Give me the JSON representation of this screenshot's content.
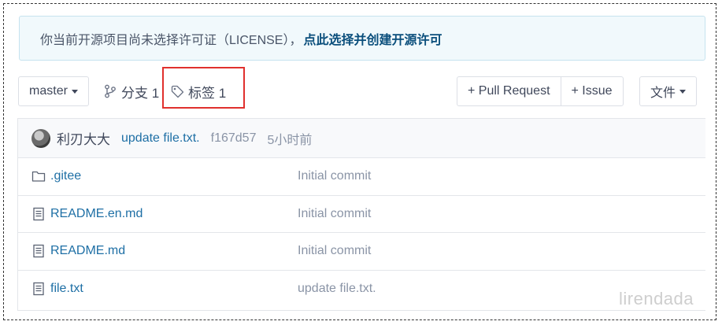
{
  "notice": {
    "text": "你当前开源项目尚未选择许可证（LICENSE），",
    "link": "点此选择并创建开源许可"
  },
  "toolbar": {
    "branch_select": "master",
    "branches_label": "分支 1",
    "tags_label": "标签 1",
    "pull_request_label": "+ Pull Request",
    "issue_label": "+ Issue",
    "files_label": "文件"
  },
  "latest_commit": {
    "author": "利刃大大",
    "message": "update file.txt.",
    "sha": "f167d57",
    "time": "5小时前"
  },
  "files": [
    {
      "name": ".gitee",
      "type": "folder-icon",
      "commit": "Initial commit"
    },
    {
      "name": "README.en.md",
      "type": "file-icon",
      "commit": "Initial commit"
    },
    {
      "name": "README.md",
      "type": "file-icon",
      "commit": "Initial commit"
    },
    {
      "name": "file.txt",
      "type": "file-icon",
      "commit": "update file.txt."
    }
  ],
  "watermark": "lirendada",
  "colors": {
    "highlight_box": "#e0302d",
    "link": "#1e6fa5",
    "notice_bg": "#f1f9fc"
  }
}
